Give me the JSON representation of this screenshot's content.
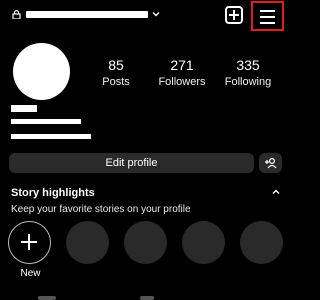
{
  "header": {
    "username": "",
    "icons": [
      "lock-icon",
      "chevron-down-icon",
      "add-post-icon",
      "hamburger-menu-icon"
    ]
  },
  "stats": [
    {
      "value": "85",
      "label": "Posts"
    },
    {
      "value": "271",
      "label": "Followers"
    },
    {
      "value": "335",
      "label": "Following"
    }
  ],
  "actions": {
    "edit_profile_label": "Edit profile"
  },
  "highlights": {
    "title": "Story highlights",
    "subtitle": "Keep your favorite stories on your profile",
    "new_label": "New",
    "placeholder_count": 4
  },
  "colors": {
    "background": "#000000",
    "button": "#2a2a2a",
    "highlight_frame": "#e01e1e"
  }
}
